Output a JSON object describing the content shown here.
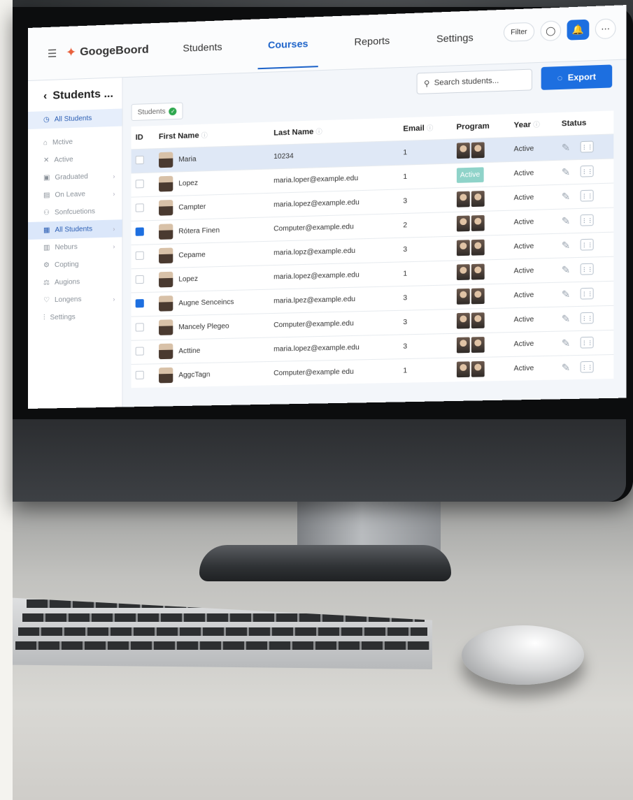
{
  "app": {
    "logo": "GoogeBoord",
    "nav": [
      "Students",
      "Courses",
      "Reports",
      "Settings"
    ],
    "active_nav": "Courses",
    "filter_label": "Filter"
  },
  "sidebar": {
    "title": "Students ...",
    "items": [
      {
        "label": "All Students",
        "icon": "clock-icon"
      },
      {
        "label": "Mctive",
        "icon": "home-icon"
      },
      {
        "label": "Active",
        "icon": "x-icon"
      },
      {
        "label": "Graduated",
        "icon": "doc-icon"
      },
      {
        "label": "On Leave",
        "icon": "file-icon"
      },
      {
        "label": "Sonfcuetions",
        "icon": "people-icon"
      },
      {
        "label": "All Students",
        "icon": "calendar-icon"
      },
      {
        "label": "Neburs",
        "icon": "grid-icon"
      },
      {
        "label": "Copting",
        "icon": "gear-icon"
      },
      {
        "label": "Augions",
        "icon": "sliders-icon"
      },
      {
        "label": "Longens",
        "icon": "heart-icon"
      },
      {
        "label": "Settings",
        "icon": "chart-icon"
      }
    ]
  },
  "toolbar": {
    "search_placeholder": "Search students...",
    "export_label": "Export",
    "chip_label": "Students"
  },
  "table": {
    "headers": [
      "ID",
      "First Name",
      "Last Name",
      "Email",
      "Program",
      "Year",
      "Status"
    ],
    "rows": [
      {
        "name": "Maria",
        "email": "10234",
        "year": "1",
        "status": "Active"
      },
      {
        "name": "Lopez",
        "email": "maria.loper@example.edu",
        "year": "1",
        "program_badge": "Active",
        "status": "Active"
      },
      {
        "name": "Campter",
        "email": "maria.lopez@example.edu",
        "year": "3",
        "status": "Active"
      },
      {
        "name": "Rótera Finen",
        "email": "Computer@example.edu",
        "year": "2",
        "status": "Active"
      },
      {
        "name": "Cepame",
        "email": "maria.lopz@example.edu",
        "year": "3",
        "status": "Active"
      },
      {
        "name": "Lopez",
        "email": "maria.lopez@example.edu",
        "year": "1",
        "status": "Active"
      },
      {
        "name": "Augne Senceincs",
        "email": "maria.lpez@example.edu",
        "year": "3",
        "status": "Active"
      },
      {
        "name": "Mancely Plegeo",
        "email": "Computer@example.edu",
        "year": "3",
        "status": "Active"
      },
      {
        "name": "Acttine",
        "email": "maria.lopez@example.edu",
        "year": "3",
        "status": "Active"
      },
      {
        "name": "AggcTagn",
        "email": "Computer@example edu",
        "year": "1",
        "status": "Active"
      }
    ]
  },
  "colors": {
    "accent": "#1d6fe0",
    "badge": "#8fd3c9"
  }
}
